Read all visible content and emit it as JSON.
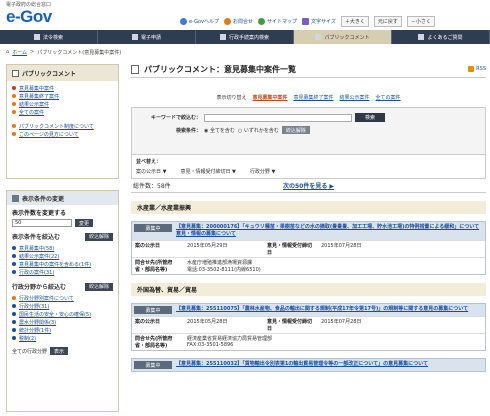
{
  "header": {
    "logo_sub": "電子政府の総合窓口",
    "logo_main": "e-Gov",
    "links": [
      "e-Govヘルプ",
      "お問合せ",
      "サイトマップ"
    ],
    "font_size_label": "文字サイズ",
    "font_buttons": [
      "＋大きく",
      "元に戻す",
      "－小さく"
    ]
  },
  "nav": [
    "法令検索",
    "電子申請",
    "行政手続案内検索",
    "パブリックコメント",
    "よくあるご質問"
  ],
  "breadcrumb": {
    "home": "ホーム",
    "sep": ">",
    "path": "パブリックコメント(意見募集中案件)"
  },
  "sidebar": {
    "title": "パブリックコメント",
    "items": [
      "意見募集中案件",
      "意見募集終了案件",
      "結果公示案件",
      "全ての案件"
    ],
    "help_items": [
      "パブリックコメント制度について",
      "このページの見方について"
    ],
    "display_title": "表示条件の変更",
    "count_label": "表示件数を変更する",
    "count_value": "50",
    "change_button": "変更",
    "filter_label": "表示条件を絞込む",
    "reset_button": "絞込解除",
    "filter_items": [
      "意見募集中(58)",
      "結果公示案件(22)",
      "意見募集中の案件を含める(1件)",
      "行政の案件(31)"
    ],
    "admin_label": "行政分野から絞込む",
    "admin_items": [
      "行政分野別案件について",
      "行政分野(31)",
      "国民生活の安全・安心の確保(5)",
      "農水分野関係(3)",
      "統計分野(1件)",
      "税制(2)"
    ],
    "other_label": "全ての行政分野",
    "display_button": "表示"
  },
  "main": {
    "title": "パブリックコメント：意見募集中案件一覧",
    "rss": "RSS",
    "tabs_label": "表示切り替え",
    "tabs": [
      "意見募集中案件",
      "意見募集終了案件",
      "結果公示案件",
      "全ての案件"
    ],
    "keyword_label": "キーワードで絞込む：",
    "search_button": "検索",
    "condition_label": "検索条件：",
    "cond_all": "全てを含む",
    "cond_any": "いずれかを含む",
    "reset_button": "絞込解除",
    "sort_label": "並べ替え：",
    "sort_options": [
      "案の公示日",
      "意見・情報受付締切日",
      "行政分野"
    ],
    "count": "総件数：58件",
    "next": "次の50件を見る",
    "categories": [
      "水産業／水産業振興",
      "外国為替、貿易／貿易"
    ],
    "cards": [
      {
        "status": "募集中",
        "title": "【意見募集：200000176】「キュウリ種苗・果樹苗などの水の摘取(畳畳畳、加工工場、貯水池工場)の特例措置による緩和」について意見・情報の募集について",
        "pub_label": "案の公示日",
        "pub": "2015年05月29日",
        "due_label": "意見・情報受付締切日",
        "due": "2015年07月28日",
        "contact_label": "問合せ先(所管府省・部局名等)",
        "contact": "水産庁増殖推進部漁場資源課\n電話:03-3502-8111(内線6510)"
      },
      {
        "status": "募集中",
        "title": "【意見募集：255110075】「農林水産物、食品の輸出に関する規制(平成17年令第17号)」の規制等に関する意見の募集について",
        "pub_label": "案の公示日",
        "pub": "2015年05月28日",
        "due_label": "意見・情報受付締切日",
        "due": "2015年07月28日",
        "contact_label": "問合せ先(所管府省・部局名等)",
        "contact": "経済産業省貿易経済協力局貿易管理部\nFAX:03-3501-5896"
      },
      {
        "status": "募集中",
        "title": "【意見募集：255110032】「貨物輸出令別表第1の輸出貿易管理令等の一部改正について」の意見募集について",
        "pub_label": "",
        "pub": "",
        "due_label": "",
        "due": "",
        "contact_label": "",
        "contact": ""
      }
    ]
  },
  "colors": {
    "nav_bg": "#2f3d52",
    "accent": "#1a4fa0",
    "status_bg": "#5c6b7c",
    "tab_active": "#d0461a"
  }
}
